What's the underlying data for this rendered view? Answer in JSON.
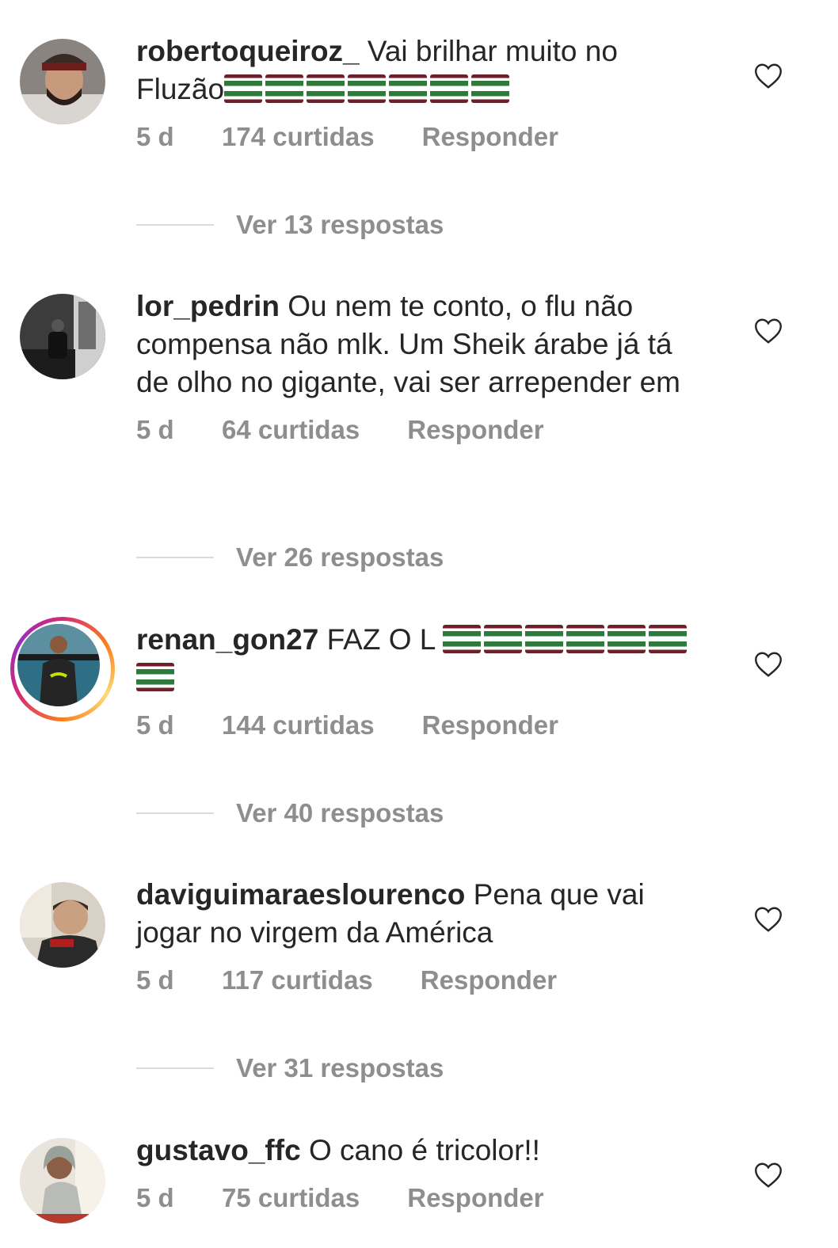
{
  "comments": [
    {
      "username": "robertoqueiroz_",
      "text": "Vai brilhar muito no Fluzão",
      "flags": 7,
      "time": "5 d",
      "likes": "174 curtidas",
      "reply_label": "Responder",
      "view_replies": "Ver 13 respostas"
    },
    {
      "username": "lor_pedrin",
      "text": "Ou nem te conto, o flu não compensa não mlk. Um Sheik árabe já tá de olho no gigante, vai ser arrepender em",
      "flags": 0,
      "time": "5 d",
      "likes": "64 curtidas",
      "reply_label": "Responder",
      "view_replies": "Ver 26 respostas"
    },
    {
      "username": "renan_gon27",
      "text": "FAZ O L",
      "flags": 7,
      "time": "5 d",
      "likes": "144 curtidas",
      "reply_label": "Responder",
      "view_replies": "Ver 40 respostas"
    },
    {
      "username": "daviguimaraeslourenco",
      "text": "Pena que vai jogar no virgem da América",
      "flags": 0,
      "time": "5 d",
      "likes": "117 curtidas",
      "reply_label": "Responder",
      "view_replies": "Ver 31 respostas"
    },
    {
      "username": "gustavo_ffc",
      "text": "O cano é tricolor!!",
      "flags": 0,
      "time": "5 d",
      "likes": "75 curtidas",
      "reply_label": "Responder",
      "view_replies": ""
    }
  ],
  "icons": {
    "like": "heart-outline-icon",
    "flag": "tricolor-flag-emoji"
  },
  "colors": {
    "text": "#262626",
    "secondary": "#8e8e8e",
    "divider": "#dbdbdb",
    "story_ring_start": "#d62976",
    "story_ring_end": "#fa7e1e"
  }
}
